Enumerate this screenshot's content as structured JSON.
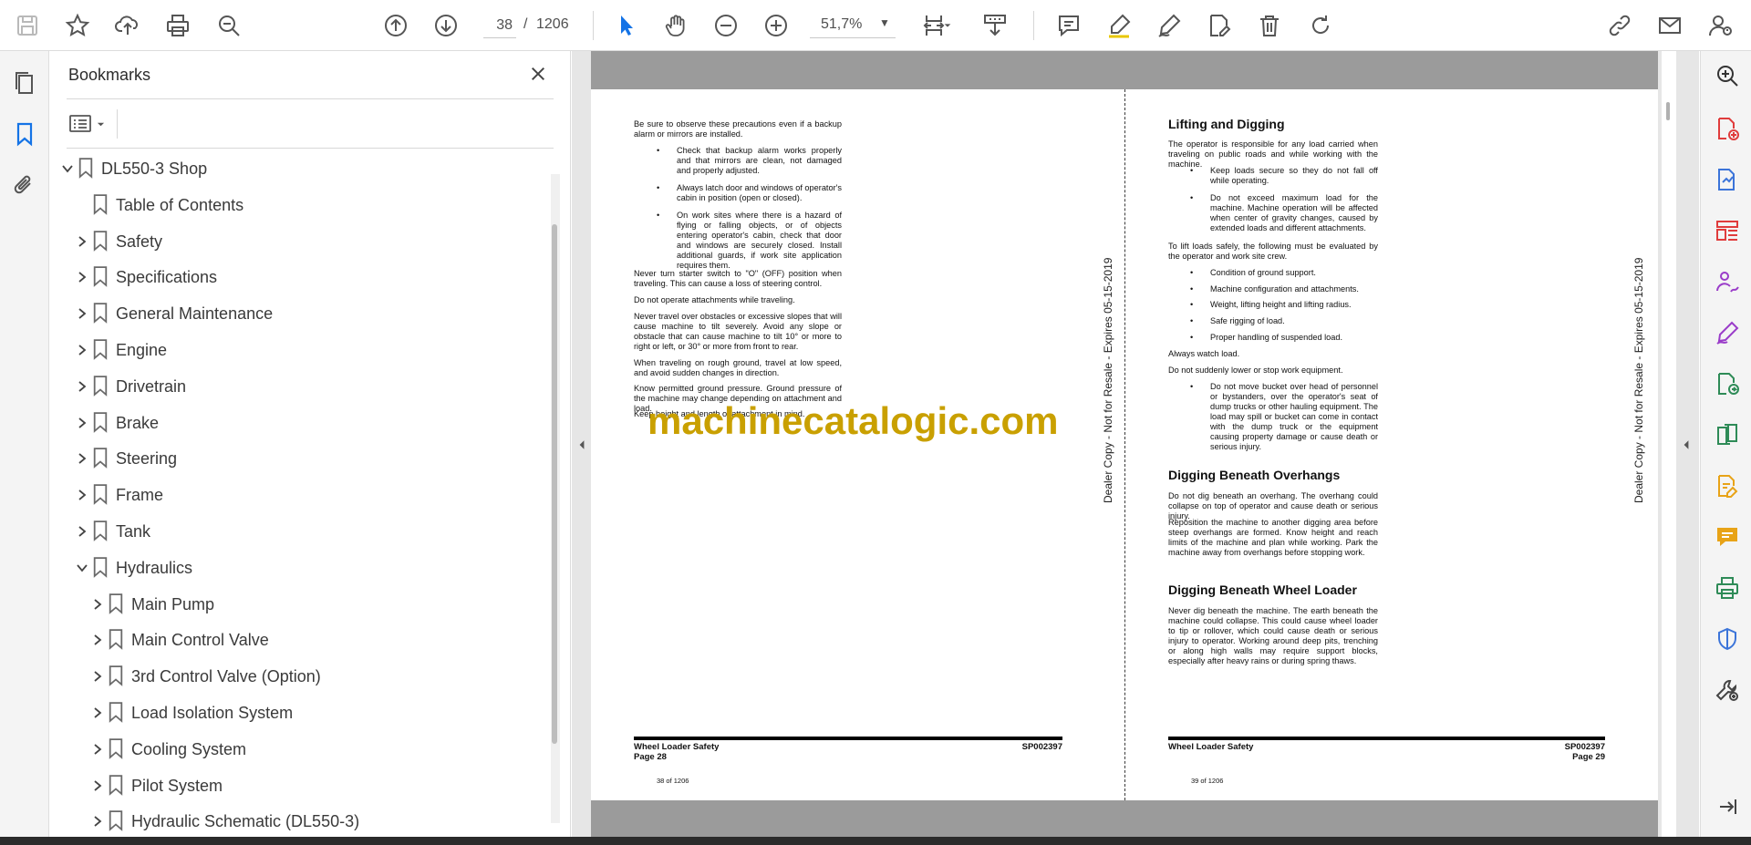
{
  "toolbar": {
    "page_current": "38",
    "page_separator": "/",
    "page_total": "1206",
    "zoom": "51,7%",
    "accent_color": "#1473e6",
    "icons": [
      "save-icon",
      "star-icon",
      "upload-icon",
      "print-icon",
      "search-zoom-icon",
      "page-up-icon",
      "page-down-icon",
      "select-cursor-icon",
      "hand-icon",
      "zoom-out-icon",
      "zoom-in-icon",
      "fit-page-icon",
      "scroll-mode-icon",
      "comment-icon",
      "highlight-icon",
      "sign-icon",
      "edit-text-icon",
      "delete-icon",
      "rotate-icon",
      "share-link-icon",
      "email-icon",
      "account-icon"
    ]
  },
  "left_rail": {
    "icons": [
      "pages-icon",
      "bookmark-icon",
      "attachment-icon"
    ]
  },
  "bookmarks": {
    "title": "Bookmarks",
    "items": [
      {
        "label": "DL550-3 Shop",
        "level": 0,
        "state": "expanded"
      },
      {
        "label": "Table of Contents",
        "level": 1,
        "state": "leaf"
      },
      {
        "label": "Safety",
        "level": 1,
        "state": "collapsed"
      },
      {
        "label": "Specifications",
        "level": 1,
        "state": "collapsed"
      },
      {
        "label": "General Maintenance",
        "level": 1,
        "state": "collapsed"
      },
      {
        "label": "Engine",
        "level": 1,
        "state": "collapsed"
      },
      {
        "label": "Drivetrain",
        "level": 1,
        "state": "collapsed"
      },
      {
        "label": "Brake",
        "level": 1,
        "state": "collapsed"
      },
      {
        "label": "Steering",
        "level": 1,
        "state": "collapsed"
      },
      {
        "label": "Frame",
        "level": 1,
        "state": "collapsed"
      },
      {
        "label": "Tank",
        "level": 1,
        "state": "collapsed"
      },
      {
        "label": "Hydraulics",
        "level": 1,
        "state": "expanded"
      },
      {
        "label": "Main Pump",
        "level": 2,
        "state": "collapsed"
      },
      {
        "label": "Main Control Valve",
        "level": 2,
        "state": "collapsed"
      },
      {
        "label": "3rd Control Valve (Option)",
        "level": 2,
        "state": "collapsed"
      },
      {
        "label": "Load Isolation System",
        "level": 2,
        "state": "collapsed"
      },
      {
        "label": "Cooling System",
        "level": 2,
        "state": "collapsed"
      },
      {
        "label": "Pilot System",
        "level": 2,
        "state": "collapsed"
      },
      {
        "label": "Hydraulic Schematic (DL550-3)",
        "level": 2,
        "state": "collapsed"
      }
    ]
  },
  "document": {
    "watermark": "machinecatalogic.com",
    "side_stamp": "Dealer Copy - Not for Resale - Expires 05-15-2019",
    "left_page": {
      "intro": "Be sure to observe these precautions even if a backup alarm or mirrors are installed.",
      "bullets": [
        "Check that backup alarm works properly and that mirrors are clean, not damaged and properly adjusted.",
        "Always latch door and windows of operator's cabin in position (open or closed).",
        "On work sites where there is a hazard of flying or falling objects, or of objects entering operator's cabin, check that door and windows are securely closed. Install additional guards, if work site application requires them."
      ],
      "para1": "Never turn starter switch to \"O\" (OFF) position when traveling. This can cause a loss of steering control.",
      "para2": "Do not operate attachments while traveling.",
      "para3": "Never travel over obstacles or excessive slopes that will cause machine to tilt severely. Avoid any slope or obstacle that can cause machine to tilt 10° or more to right or left, or 30° or more from front to rear.",
      "para4": "When traveling on rough ground, travel at low speed, and avoid sudden changes in direction.",
      "para5": "Know permitted ground pressure. Ground pressure of the machine may change depending on attachment and load.",
      "para6": "Keep height and length of attachment in mind.",
      "footer_title": "Wheel Loader Safety",
      "footer_code": "SP002397",
      "footer_page": "Page 28",
      "footer_count": "38 of 1206"
    },
    "right_page": {
      "h1": "Lifting and Digging",
      "p1": "The operator is responsible for any load carried when traveling on public roads and while working with the machine.",
      "b1": [
        "Keep loads secure so they do not fall off while operating.",
        "Do not exceed maximum load for the machine. Machine operation will be affected when center of gravity changes, caused by extended loads and different attachments."
      ],
      "p2": "To lift loads safely, the following must be evaluated by the operator and work site crew.",
      "b2": [
        "Condition of ground support.",
        "Machine configuration and attachments.",
        "Weight, lifting height and lifting radius.",
        "Safe rigging of load.",
        "Proper handling of suspended load."
      ],
      "p3": "Always watch load.",
      "p4": "Do not suddenly lower or stop work equipment.",
      "b3": [
        "Do not move bucket over head of personnel or bystanders, over the operator's seat of dump trucks or other hauling equipment. The load may spill or bucket can come in contact with the dump truck or the equipment causing property damage or cause death or serious injury."
      ],
      "h2": "Digging Beneath Overhangs",
      "p5": "Do not dig beneath an overhang. The overhang could collapse on top of operator and cause death or serious injury.",
      "p6": "Reposition the machine to another digging area before steep overhangs are formed. Know height and reach limits of the machine and plan while working. Park the machine away from overhangs before stopping work.",
      "h3": "Digging Beneath Wheel Loader",
      "p7": "Never dig beneath the machine. The earth beneath the machine could collapse. This could cause wheel loader to tip or rollover, which could cause death or serious injury to operator. Working around deep pits, trenching or along high walls may require support blocks, especially after heavy rains or during spring thaws.",
      "footer_title": "Wheel Loader Safety",
      "footer_code": "SP002397",
      "footer_page": "Page 29",
      "footer_count": "39 of 1206"
    }
  },
  "right_rail": {
    "icons": [
      "zoom-search-icon",
      "create-pdf-icon",
      "export-pdf-icon",
      "organize-pages-icon",
      "request-signature-icon",
      "fill-sign-icon",
      "send-for-comments-icon",
      "compare-files-icon",
      "edit-pdf-icon",
      "comment-tool-icon",
      "print-production-icon",
      "protect-icon",
      "more-tools-icon",
      "expand-panel-icon"
    ],
    "colors": [
      "#333333",
      "#e03c3c",
      "#3b74d9",
      "#e03c3c",
      "#9a3cc9",
      "#9a3cc9",
      "#2e8b57",
      "#2e8b57",
      "#e8a317",
      "#e8a317",
      "#2e8b57",
      "#3b74d9",
      "#444444",
      "#444444"
    ]
  }
}
